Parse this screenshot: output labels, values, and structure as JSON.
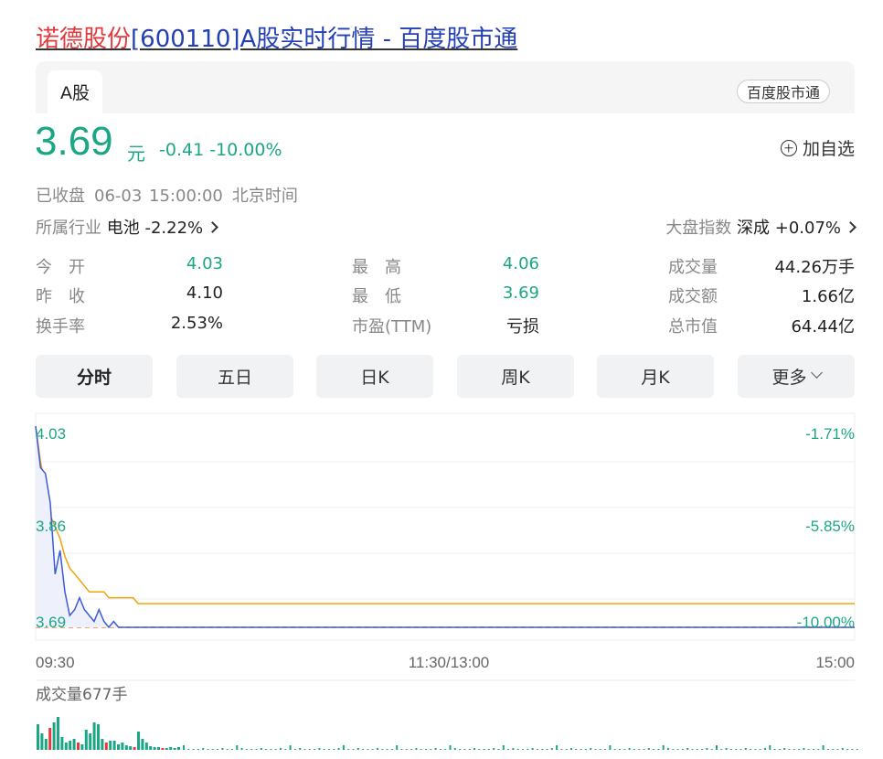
{
  "title": {
    "name": "诺德股份",
    "rest": "[600110]A股实时行情 - 百度股市通"
  },
  "tabs": {
    "active": "A股",
    "source_badge": "百度股市通"
  },
  "quote": {
    "price": "3.69",
    "unit": "元",
    "change": "-0.41 -10.00%",
    "add_watch": "加自选"
  },
  "status": {
    "state": "已收盘",
    "time": "06-03 15:00:00",
    "zone": "北京时间"
  },
  "industry": {
    "label": "所属行业",
    "name": "电池",
    "change": "-2.22%"
  },
  "market_index": {
    "label": "大盘指数",
    "name": "深成",
    "change": "+0.07%"
  },
  "stats": [
    [
      {
        "label": "今　开",
        "value": "4.03",
        "color": "green"
      },
      {
        "label": "最　高",
        "value": "4.06",
        "color": "green"
      },
      {
        "label": "成交量",
        "value": "44.26万手",
        "color": "dark"
      }
    ],
    [
      {
        "label": "昨　收",
        "value": "4.10",
        "color": "dark"
      },
      {
        "label": "最　低",
        "value": "3.69",
        "color": "green"
      },
      {
        "label": "成交额",
        "value": "1.66亿",
        "color": "dark"
      }
    ],
    [
      {
        "label": "换手率",
        "value": "2.53%",
        "color": "dark"
      },
      {
        "label": "市盈(TTM)",
        "value": "亏损",
        "color": "dark"
      },
      {
        "label": "总市值",
        "value": "64.44亿",
        "color": "dark"
      }
    ]
  ],
  "periods": [
    "分时",
    "五日",
    "日K",
    "周K",
    "月K",
    "更多"
  ],
  "chart_labels": {
    "price_top": "4.03",
    "price_mid": "3.86",
    "price_bottom": "3.69",
    "pct_top": "-1.71%",
    "pct_mid": "-5.85%",
    "pct_bottom": "-10.00%",
    "time_start": "09:30",
    "time_mid": "11:30/13:00",
    "time_end": "15:00",
    "volume_label": "成交量677手"
  },
  "colors": {
    "down": "#1ba784",
    "up": "#e4393c",
    "price_line": "#3b5bdb",
    "avg_line": "#f0a30a",
    "link": "#2440b3"
  },
  "chart_data": {
    "type": "line",
    "title": "",
    "xlabel": "",
    "ylabel": "",
    "x_range": [
      "09:30",
      "15:00"
    ],
    "ylim": [
      3.69,
      4.03
    ],
    "series": [
      {
        "name": "",
        "values": [
          4.03,
          3.96,
          3.95,
          3.9,
          3.78,
          3.82,
          3.75,
          3.71,
          3.72,
          3.74,
          3.72,
          3.71,
          3.7,
          3.72,
          3.7,
          3.69,
          3.7,
          3.69,
          3.69,
          3.69,
          3.69,
          3.69,
          3.69,
          3.69,
          3.69,
          3.69,
          3.69,
          3.69,
          3.69,
          3.69,
          3.69
        ]
      },
      {
        "name": "",
        "values": [
          4.03,
          3.97,
          3.93,
          3.88,
          3.86,
          3.84,
          3.81,
          3.79,
          3.78,
          3.77,
          3.76,
          3.75,
          3.75,
          3.75,
          3.75,
          3.74,
          3.74,
          3.74,
          3.74,
          3.74,
          3.74,
          3.73,
          3.73,
          3.73,
          3.73,
          3.73,
          3.73,
          3.73,
          3.73,
          3.73,
          3.73
        ]
      }
    ]
  }
}
